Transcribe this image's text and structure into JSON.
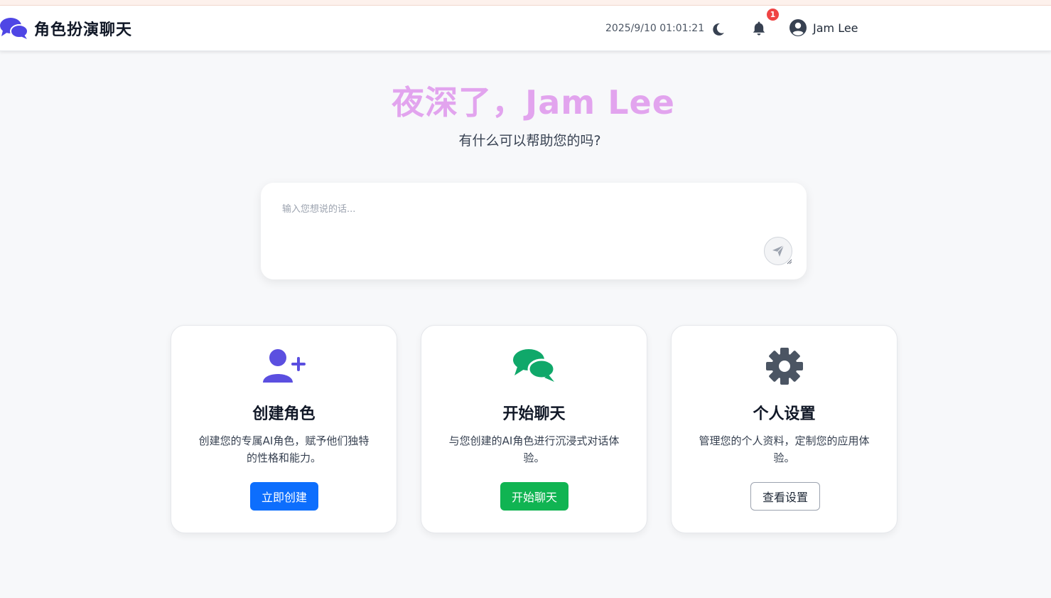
{
  "colors": {
    "brand": "#4f46e5",
    "greeting": "#e2a4ee",
    "badge": "#ef4444",
    "create_icon": "#5b4fe0",
    "chat_icon": "#10a86a",
    "settings_icon": "#4b5563",
    "btn_create": "#0d6efd",
    "btn_chat": "#10b452"
  },
  "header": {
    "brand_icon": "comments-icon",
    "title": "角色扮演聊天",
    "datetime": "2025/9/10 01:01:21",
    "theme_icon": "moon-icon",
    "notification_icon": "bell-icon",
    "notification_count": "1",
    "user_icon": "user-circle-icon",
    "user_name": "Jam Lee"
  },
  "hero": {
    "greeting": "夜深了，Jam Lee",
    "subtitle": "有什么可以帮助您的吗?"
  },
  "chat": {
    "placeholder": "输入您想说的话...",
    "value": "",
    "send_icon": "paper-plane-icon"
  },
  "cards": [
    {
      "icon": "user-plus-icon",
      "title": "创建角色",
      "description": "创建您的专属AI角色，赋予他们独特的性格和能力。",
      "button": "立即创建"
    },
    {
      "icon": "comments-icon",
      "title": "开始聊天",
      "description": "与您创建的AI角色进行沉浸式对话体验。",
      "button": "开始聊天"
    },
    {
      "icon": "gear-icon",
      "title": "个人设置",
      "description": "管理您的个人资料，定制您的应用体验。",
      "button": "查看设置"
    }
  ]
}
